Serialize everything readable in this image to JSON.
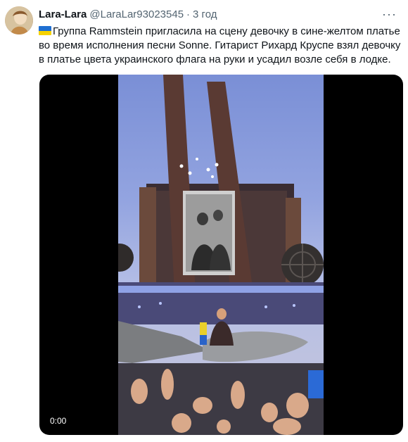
{
  "tweet": {
    "author_name": "Lara-Lara",
    "author_handle": "@LaraLar93023545",
    "separator": "·",
    "time": "3 год",
    "more_label": "···",
    "flag_icon": "ukraine-flag",
    "text_line1": "Группа Rammstein пригласила на сцену девочку в сине-желтом платье",
    "text_line2": "во время исполнения песни Sonne.  Гитарист Рихард Круспе взял девочку",
    "text_line3": "в платье цвета украинского флага на руки и усадил возле себя в лодке."
  },
  "video": {
    "timestamp": "0:00"
  },
  "colors": {
    "name": "#0f1419",
    "secondary": "#536471",
    "flag_blue": "#1f6fd1",
    "flag_yellow": "#f6d200"
  }
}
